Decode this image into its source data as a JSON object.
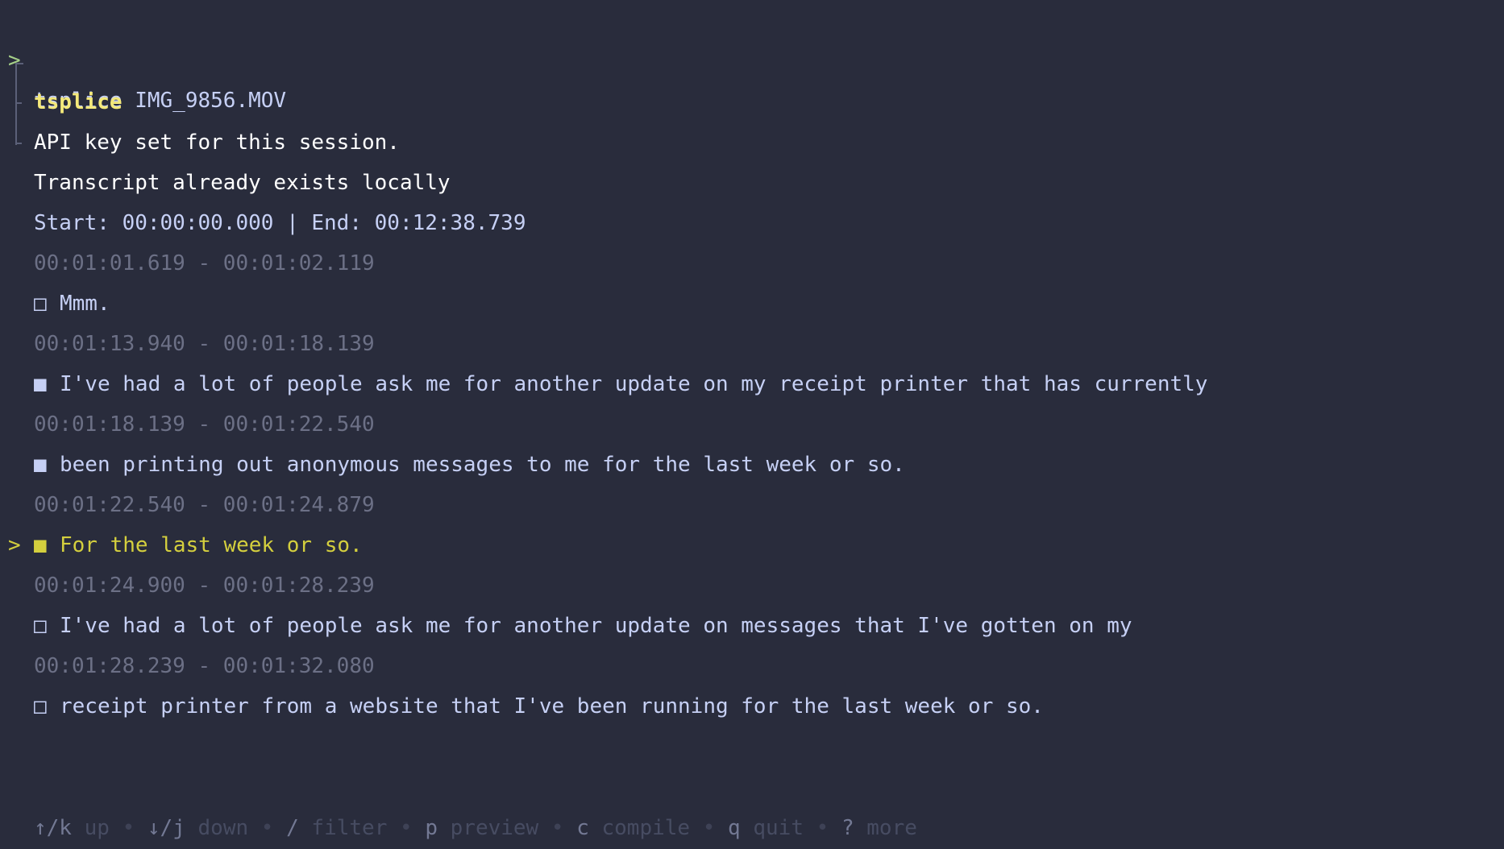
{
  "prompt": {
    "caret": ">",
    "command": "tsplice IMG_9856.MOV"
  },
  "header": {
    "app_name": "tsplice",
    "messages": [
      "API key set for this session.",
      "Transcript already exists locally"
    ],
    "range": "Start: 00:00:00.000 | End: 00:12:38.739"
  },
  "segments": [
    {
      "time": "00:01:01.619 - 00:01:02.119",
      "checkbox": "□",
      "text": "Mmm.",
      "selected": false,
      "cursor": ""
    },
    {
      "time": "00:01:13.940 - 00:01:18.139",
      "checkbox": "■",
      "text": "I've had a lot of people ask me for another update on my receipt printer that has currently",
      "selected": true,
      "cursor": ""
    },
    {
      "time": "00:01:18.139 - 00:01:22.540",
      "checkbox": "■",
      "text": "been printing out anonymous messages to me for the last week or so.",
      "selected": true,
      "cursor": ""
    },
    {
      "time": "00:01:22.540 - 00:01:24.879",
      "checkbox": "■",
      "text": "For the last week or so.",
      "selected": true,
      "cursor": ">"
    },
    {
      "time": "00:01:24.900 - 00:01:28.239",
      "checkbox": "□",
      "text": "I've had a lot of people ask me for another update on messages that I've gotten on my",
      "selected": false,
      "cursor": ""
    },
    {
      "time": "00:01:28.239 - 00:01:32.080",
      "checkbox": "□",
      "text": "receipt printer from a website that I've been running for the last week or so.",
      "selected": false,
      "cursor": ""
    }
  ],
  "help_bar": [
    {
      "key": "↑/k",
      "desc": "up"
    },
    {
      "key": "↓/j",
      "desc": "down"
    },
    {
      "key": "/",
      "desc": "filter"
    },
    {
      "key": "p",
      "desc": "preview"
    },
    {
      "key": "c",
      "desc": "compile"
    },
    {
      "key": "q",
      "desc": "quit"
    },
    {
      "key": "?",
      "desc": "more"
    }
  ],
  "help_separator": "•",
  "colors": {
    "background": "#292c3c",
    "prompt_caret": "#a6d189",
    "title": "#f4e97a",
    "active_row": "#d4cf3e",
    "timestamp": "#6c7086"
  }
}
